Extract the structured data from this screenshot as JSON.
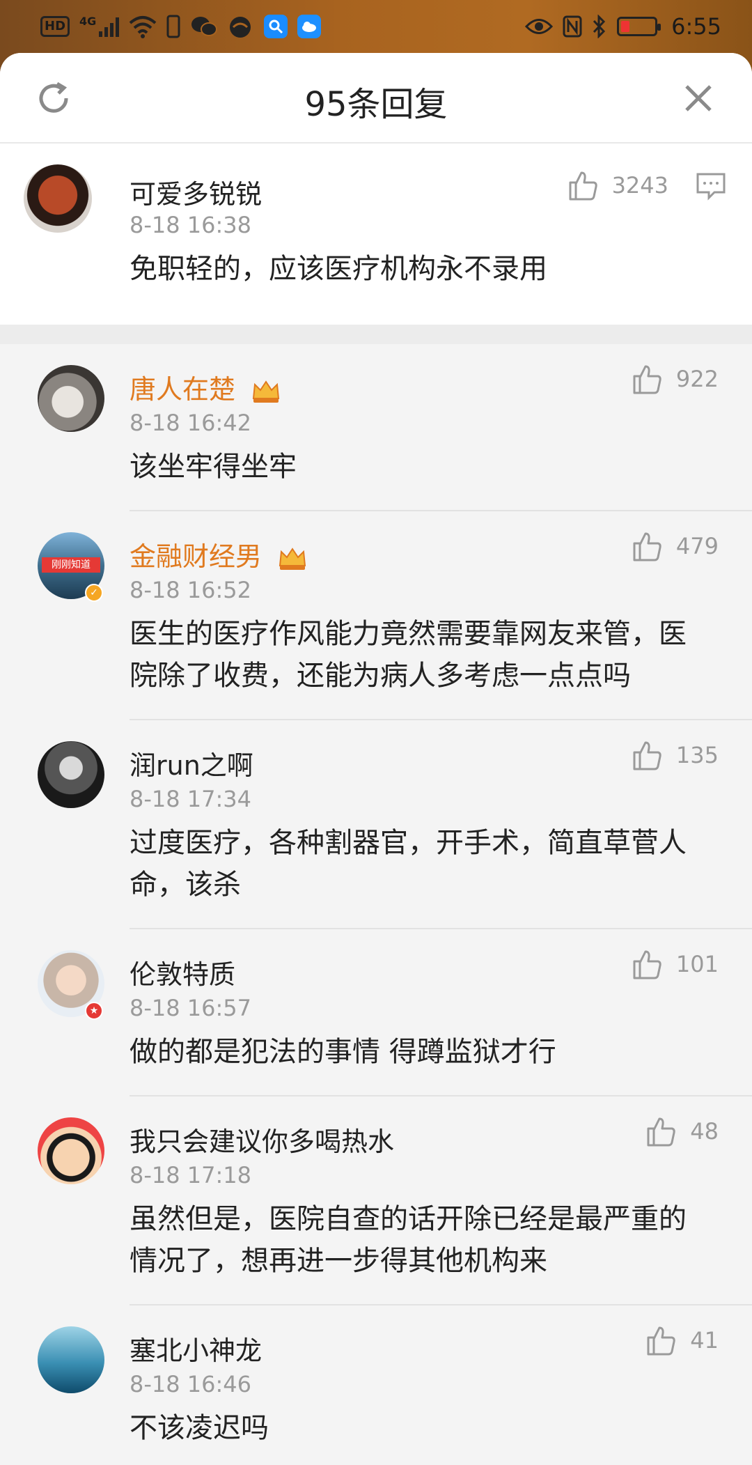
{
  "status_bar": {
    "hd": "HD",
    "network": "4G",
    "time": "6:55"
  },
  "header": {
    "title": "95条回复"
  },
  "main_comment": {
    "name": "可爱多锐锐",
    "time": "8-18 16:38",
    "likes": "3243",
    "text": "免职轻的，应该医疗机构永不录用"
  },
  "replies": [
    {
      "name": "唐人在楚",
      "time": "8-18 16:42",
      "likes": "922",
      "lines": [
        "该坐牢得坐牢"
      ]
    },
    {
      "name": "金融财经男",
      "time": "8-18 16:52",
      "likes": "479",
      "lines": [
        "医生的医疗作风能力竟然需要靠网友来管，医",
        "院除了收费，还能为病人多考虑一点点吗"
      ],
      "avatar_text": "刚刚知道"
    },
    {
      "name": "润run之啊",
      "time": "8-18 17:34",
      "likes": "135",
      "lines": [
        "过度医疗，各种割器官，开手术，简直草菅人",
        "命，该杀"
      ]
    },
    {
      "name": "伦敦特质",
      "time": "8-18 16:57",
      "likes": "101",
      "lines": [
        "做的都是犯法的事情 得蹲监狱才行"
      ]
    },
    {
      "name": "我只会建议你多喝热水",
      "time": "8-18 17:18",
      "likes": "48",
      "lines": [
        "虽然但是，医院自查的话开除已经是最严重的",
        "情况了，想再进一步得其他机构来"
      ]
    },
    {
      "name": "塞北小神龙",
      "time": "8-18 16:46",
      "likes": "41",
      "lines": [
        "不该凌迟吗"
      ]
    }
  ],
  "colors": {
    "vip_name": "#e07a1f",
    "text": "#222222",
    "meta": "#9a9a9a",
    "background": "#f4f4f4"
  }
}
